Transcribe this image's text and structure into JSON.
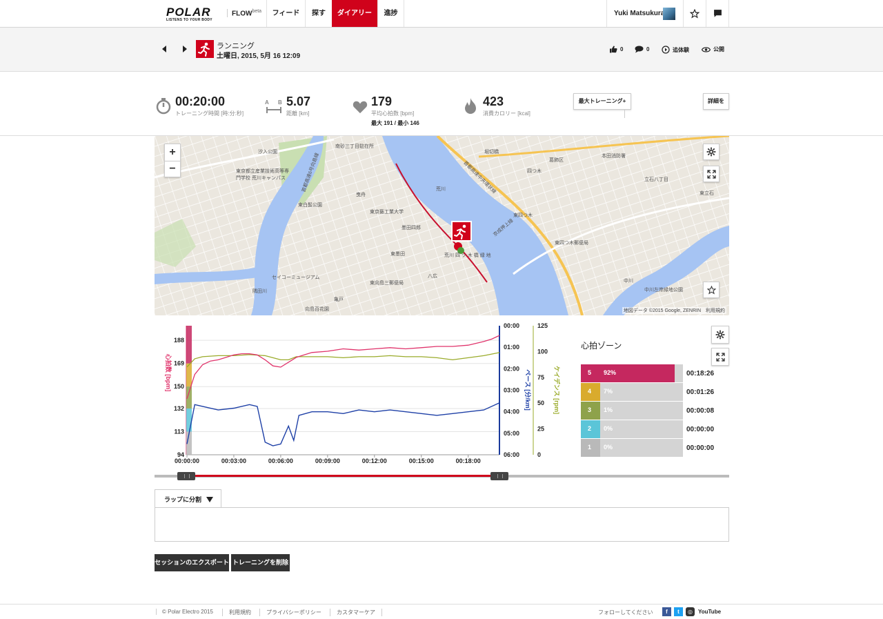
{
  "nav": {
    "brand": "POLAR",
    "tagline": "LISTENS TO YOUR BODY",
    "product": "FLOW",
    "product_suffix": "beta",
    "tabs": [
      {
        "label": "フィード",
        "active": false
      },
      {
        "label": "探す",
        "active": false
      },
      {
        "label": "ダイアリー",
        "active": true
      },
      {
        "label": "進捗",
        "active": false
      }
    ],
    "user_name": "Yuki Matsukura",
    "accent_color": "#d0021b"
  },
  "session": {
    "sport": "ランニング",
    "date": "土曜日, 2015, 5月 16 12:09",
    "likes": "0",
    "comments": "0",
    "follow_label": "追体験",
    "visibility_label": "公開"
  },
  "summary": {
    "duration": "00:20:00",
    "duration_label": "トレーニング時間 [時:分:秒]",
    "distance": "5.07",
    "distance_label": "距離 [km]",
    "hr_avg": "179",
    "hr_label": "平均心拍数 [bpm]",
    "hr_minmax": "最大 191  /  最小 146",
    "calories": "423",
    "calories_label": "消費カロリー [kcal]",
    "benefit_button": "最大トレーニング+",
    "details_button": "詳細を"
  },
  "map": {
    "zoom_in": "+",
    "zoom_out": "−",
    "attribution": "地図データ ©2015 Google, ZENRIN　利用規約",
    "labels": [
      "汐入公園",
      "東京都立産業技術高等専門学校 荒川キャンパス",
      "東白髭公園",
      "曳舟",
      "墨田四郎",
      "東京藝工業大学",
      "南砂三丁目駐在所",
      "堀切橋",
      "荒川",
      "首都高速6号向島線",
      "首都高速中央環状線",
      "葛飾区",
      "四つ木",
      "東四つ木",
      "東四つ木郵便局",
      "本田消防署",
      "東立石",
      "立石八丁目",
      "八広",
      "東墨田",
      "セイコーミュージアム",
      "東向島三郵便局",
      "中川",
      "中川左岸緑地公園",
      "京成押上線",
      "亀戸",
      "隅田川",
      "向島百花園",
      "荒川 四 ツ 木 橋 緑 地"
    ]
  },
  "chart_data": {
    "type": "line",
    "x_ticks": [
      "00:00:00",
      "00:03:00",
      "00:06:00",
      "00:09:00",
      "00:12:00",
      "00:15:00",
      "00:18:00"
    ],
    "xlim": [
      "00:00:00",
      "00:20:00"
    ],
    "axes": {
      "left": {
        "label": "心拍数 [bpm]",
        "ticks": [
          94,
          113,
          132,
          150,
          169,
          188
        ],
        "ylim": [
          94,
          200
        ],
        "color": "#d6336c"
      },
      "pace": {
        "label": "ペース [分/km]",
        "ticks": [
          "00:00",
          "01:00",
          "02:00",
          "03:00",
          "04:00",
          "05:00",
          "06:00"
        ],
        "ylim": [
          "06:00",
          "00:00"
        ],
        "color": "#1a3a9c"
      },
      "cadence": {
        "label": "ケイデンス [rpm]",
        "ticks": [
          0,
          25,
          50,
          75,
          100,
          125
        ],
        "ylim": [
          0,
          125
        ],
        "color": "#9aab2a"
      }
    },
    "series": [
      {
        "name": "心拍数 [bpm]",
        "color": "#e0336b",
        "x": [
          "00:00:00",
          "00:00:30",
          "00:01:00",
          "00:01:30",
          "00:02:00",
          "00:02:30",
          "00:03:00",
          "00:03:30",
          "00:04:00",
          "00:04:30",
          "00:05:00",
          "00:05:30",
          "00:06:00",
          "00:06:30",
          "00:07:00",
          "00:07:30",
          "00:08:00",
          "00:09:00",
          "00:10:00",
          "00:11:00",
          "00:12:00",
          "00:13:00",
          "00:14:00",
          "00:15:00",
          "00:16:00",
          "00:17:00",
          "00:18:00",
          "00:19:00",
          "00:19:30",
          "00:20:00"
        ],
        "values": [
          140,
          160,
          168,
          171,
          172,
          174,
          176,
          177,
          177,
          176,
          172,
          167,
          166,
          170,
          174,
          176,
          178,
          179,
          181,
          180,
          181,
          182,
          181,
          182,
          183,
          183,
          184,
          187,
          189,
          192
        ]
      },
      {
        "name": "ケイデンス [rpm]",
        "color": "#9aab2a",
        "x": [
          "00:00:00",
          "00:00:30",
          "00:01:00",
          "00:02:00",
          "00:03:00",
          "00:04:00",
          "00:05:00",
          "00:05:30",
          "00:06:00",
          "00:06:30",
          "00:07:00",
          "00:08:00",
          "00:09:00",
          "00:10:00",
          "00:11:00",
          "00:12:00",
          "00:13:00",
          "00:14:00",
          "00:15:00",
          "00:16:00",
          "00:17:00",
          "00:18:00",
          "00:19:00",
          "00:20:00"
        ],
        "values": [
          85,
          93,
          95,
          96,
          96,
          97,
          96,
          94,
          92,
          92,
          95,
          95,
          95,
          94,
          95,
          95,
          96,
          95,
          95,
          94,
          92,
          94,
          96,
          99
        ]
      },
      {
        "name": "ペース [分/km]",
        "color": "#1d3fa6",
        "x": [
          "00:00:00",
          "00:00:30",
          "00:01:00",
          "00:02:00",
          "00:03:00",
          "00:04:00",
          "00:04:30",
          "00:05:00",
          "00:05:30",
          "00:06:00",
          "00:06:30",
          "00:06:50",
          "00:07:10",
          "00:08:00",
          "00:09:00",
          "00:10:00",
          "00:11:00",
          "00:12:00",
          "00:13:00",
          "00:14:00",
          "00:15:00",
          "00:16:00",
          "00:17:00",
          "00:18:00",
          "00:19:00",
          "00:20:00"
        ],
        "values": [
          "05:30",
          "03:40",
          "03:45",
          "03:55",
          "03:50",
          "03:40",
          "03:45",
          "05:25",
          "05:35",
          "05:30",
          "04:40",
          "05:20",
          "04:10",
          "04:00",
          "04:00",
          "04:05",
          "03:55",
          "04:00",
          "03:55",
          "04:00",
          "04:05",
          "04:10",
          "04:05",
          "04:00",
          "03:55",
          "03:35"
        ]
      }
    ]
  },
  "zones": {
    "title": "心拍ゾーン",
    "rows": [
      {
        "zone": "5",
        "pct": "92%",
        "fraction": 0.92,
        "time": "00:18:26",
        "color": "#c5285f"
      },
      {
        "zone": "4",
        "pct": "7%",
        "fraction": 0.07,
        "time": "00:01:26",
        "color": "#d9ab2d"
      },
      {
        "zone": "3",
        "pct": "1%",
        "fraction": 0.01,
        "time": "00:00:08",
        "color": "#8ea24b"
      },
      {
        "zone": "2",
        "pct": "0%",
        "fraction": 0.0,
        "time": "00:00:00",
        "color": "#5bc5d8"
      },
      {
        "zone": "1",
        "pct": "0%",
        "fraction": 0.0,
        "time": "00:00:00",
        "color": "#b9b9b9"
      }
    ]
  },
  "actions": {
    "laps_button": "ラップに分割",
    "export_button": "セッションのエクスポート",
    "delete_button": "トレーニングを削除"
  },
  "footer": {
    "copyright": "© Polar Electro 2015",
    "links": [
      "利用規約",
      "プライバシーポリシー",
      "カスタマーケア"
    ],
    "follow": "フォローしてください",
    "social": [
      "facebook",
      "twitter",
      "instagram",
      "youtube"
    ],
    "youtube_label": "YouTube"
  }
}
